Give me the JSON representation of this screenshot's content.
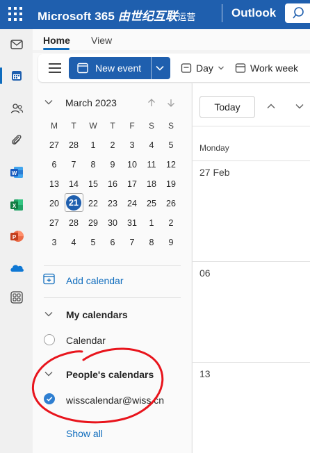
{
  "header": {
    "brand": "Microsoft 365",
    "brand_suffix": "由世纪互联",
    "brand_sub": "运营",
    "app_name": "Outlook",
    "bg_color": "#1f5fae"
  },
  "rail": {
    "items": [
      "mail-icon",
      "calendar-icon",
      "people-icon",
      "attachment-icon",
      "word-icon",
      "excel-icon",
      "powerpoint-icon",
      "onedrive-icon",
      "more-apps-icon"
    ],
    "active": "calendar-icon"
  },
  "ribbon": {
    "tabs": [
      {
        "label": "Home",
        "active": true
      },
      {
        "label": "View",
        "active": false
      }
    ],
    "new_event": "New event",
    "day": "Day",
    "work_week": "Work week"
  },
  "mini_calendar": {
    "month_label": "March 2023",
    "weekdays": [
      "M",
      "T",
      "W",
      "T",
      "F",
      "S",
      "S"
    ],
    "weeks": [
      [
        "27",
        "28",
        "1",
        "2",
        "3",
        "4",
        "5"
      ],
      [
        "6",
        "7",
        "8",
        "9",
        "10",
        "11",
        "12"
      ],
      [
        "13",
        "14",
        "15",
        "16",
        "17",
        "18",
        "19"
      ],
      [
        "20",
        "21",
        "22",
        "23",
        "24",
        "25",
        "26"
      ],
      [
        "27",
        "28",
        "29",
        "30",
        "31",
        "1",
        "2"
      ],
      [
        "3",
        "4",
        "5",
        "6",
        "7",
        "8",
        "9"
      ]
    ],
    "today": "21"
  },
  "sidebar": {
    "add_calendar": "Add calendar",
    "my_calendars": "My calendars",
    "calendar_item": "Calendar",
    "peoples_calendars": "People's calendars",
    "shared_calendar": "wisscalendar@wiss.cn",
    "show_all": "Show all"
  },
  "main": {
    "today_button": "Today",
    "day_header": "Monday",
    "dates": [
      "27 Feb",
      "06",
      "13"
    ]
  },
  "annotation": {
    "color": "#e8141c"
  }
}
